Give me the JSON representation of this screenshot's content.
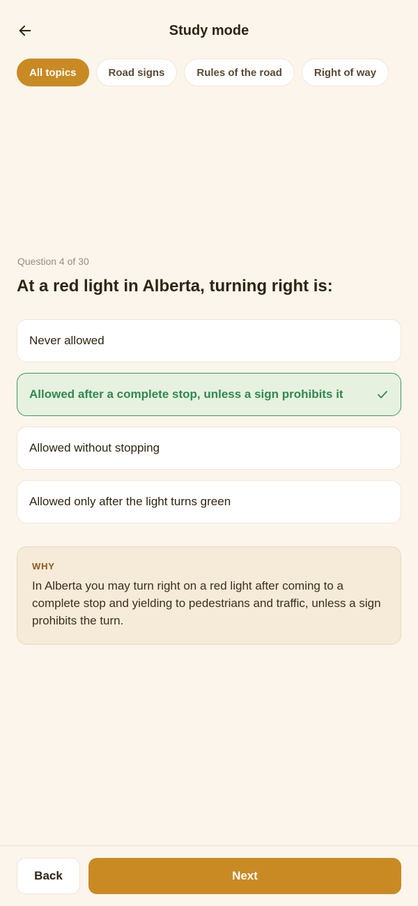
{
  "header": {
    "title": "Study mode",
    "back_icon": "arrow-left-icon"
  },
  "tabs": [
    {
      "label": "All topics",
      "active": true
    },
    {
      "label": "Road signs",
      "active": false
    },
    {
      "label": "Rules of the road",
      "active": false
    },
    {
      "label": "Right of way",
      "active": false
    }
  ],
  "quiz": {
    "progress_text": "Question 4 of 30",
    "current": 4,
    "total": 30,
    "question": "At a red light in Alberta, turning right is:",
    "options": [
      {
        "label": "Never allowed",
        "correct": false
      },
      {
        "label": "Allowed after a complete stop, unless a sign prohibits it",
        "correct": true
      },
      {
        "label": "Allowed without stopping",
        "correct": false
      },
      {
        "label": "Allowed only after the light turns green",
        "correct": false
      }
    ],
    "explanation": {
      "label": "WHY",
      "text": "In Alberta you may turn right on a red light after coming to a complete stop and yielding to pedestrians and traffic, unless a sign prohibits the turn."
    }
  },
  "footer": {
    "back_label": "Back",
    "next_label": "Next"
  },
  "colors": {
    "accent": "#c98a24",
    "background": "#fcf5ec",
    "correct": "#2e8a4e",
    "explanation_bg": "#f6ead8"
  }
}
